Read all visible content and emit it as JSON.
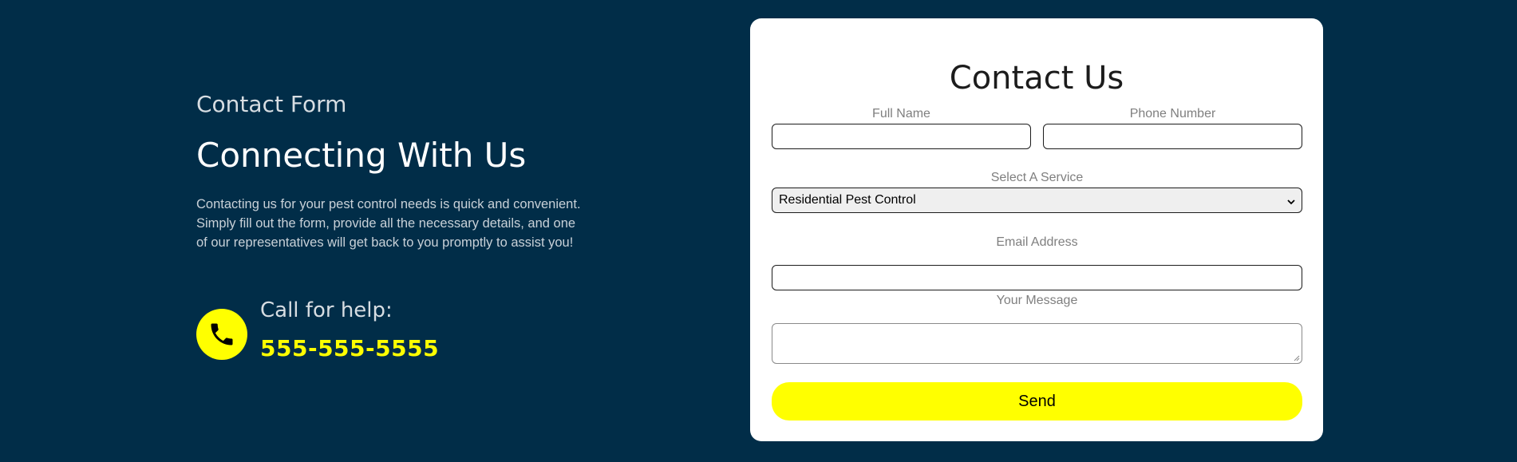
{
  "intro": {
    "eyebrow": "Contact Form",
    "heading": "Connecting With Us",
    "description": "Contacting us for your pest control needs is quick and convenient. Simply fill out the form, provide all the necessary details, and one of our representatives will get back to you promptly to assist you!"
  },
  "help": {
    "label": "Call for help:",
    "phone": "555-555-5555",
    "icon": "phone-icon"
  },
  "form": {
    "title": "Contact Us",
    "full_name_label": "Full Name",
    "full_name_value": "",
    "phone_label": "Phone Number",
    "phone_value": "",
    "service_label": "Select A Service",
    "service_selected": "Residential Pest Control",
    "email_label": "Email Address",
    "email_value": "",
    "message_label": "Your Message",
    "message_value": "",
    "send_label": "Send"
  },
  "colors": {
    "background": "#012d48",
    "accent": "#ffff00",
    "card": "#ffffff"
  }
}
